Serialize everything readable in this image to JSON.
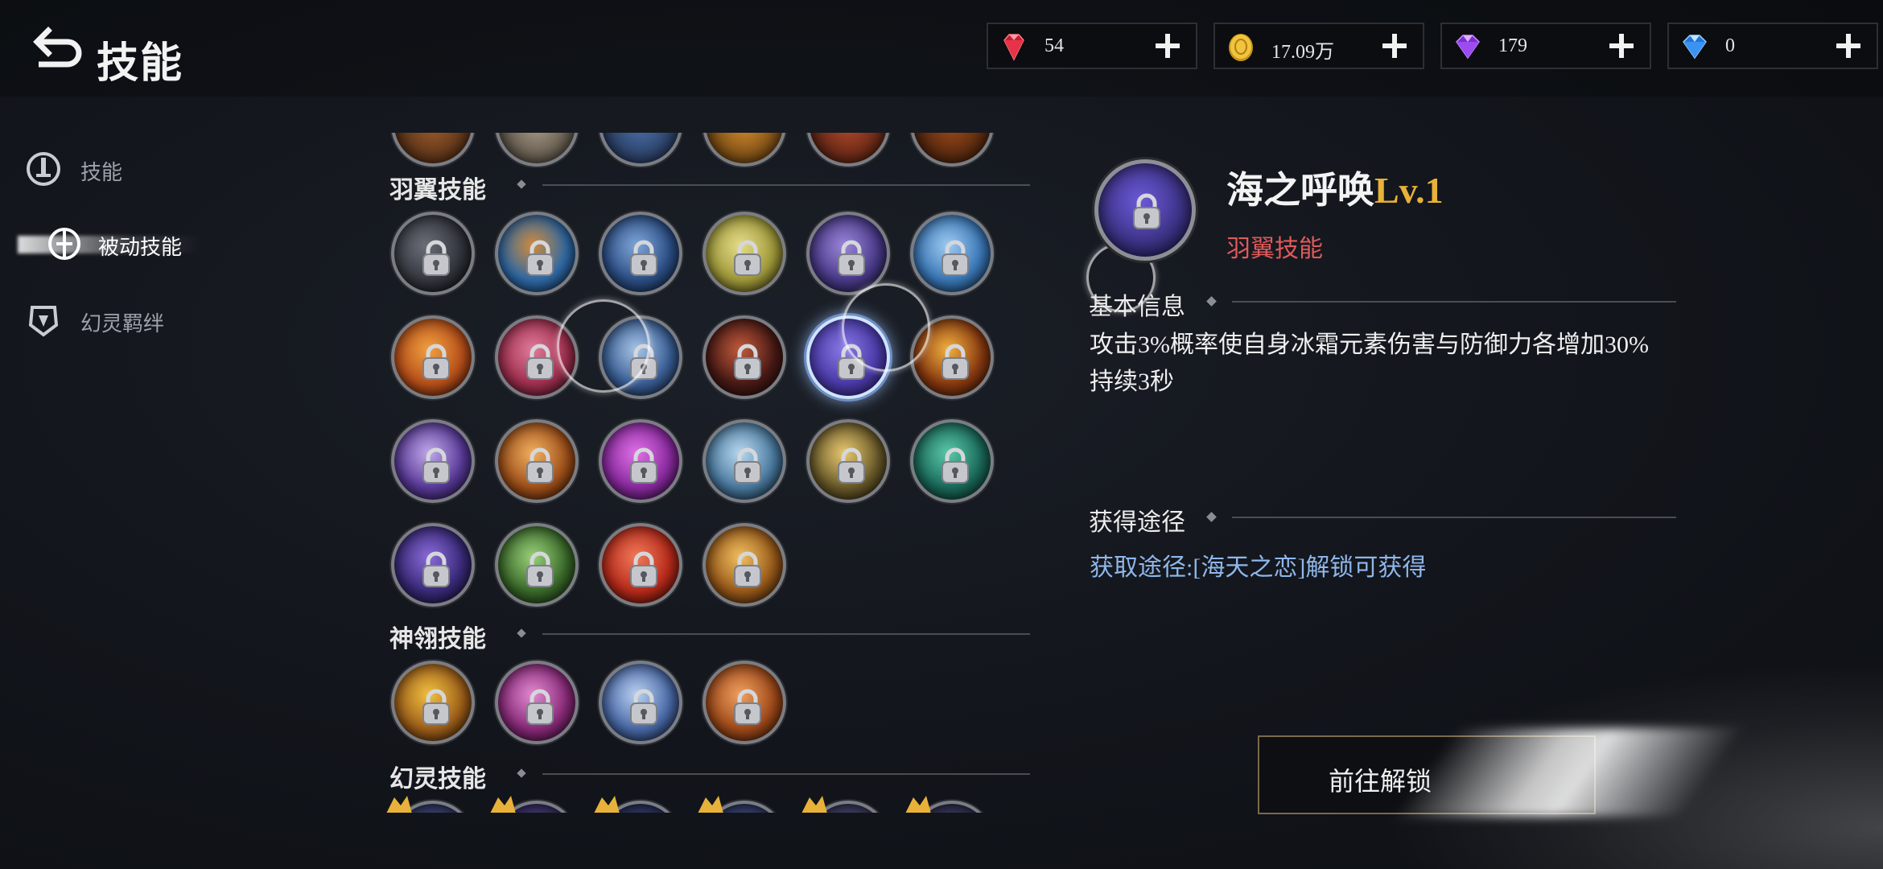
{
  "header": {
    "title": "技能",
    "back_icon": "back-arrow-icon"
  },
  "currencies": [
    {
      "name": "ruby",
      "icon": "red-gem-icon",
      "value": "54",
      "color": "#d3243a"
    },
    {
      "name": "gold",
      "icon": "gold-coin-icon",
      "value": "17.09万",
      "color": "#d9a921"
    },
    {
      "name": "amethyst",
      "icon": "purple-gem-icon",
      "value": "179",
      "color": "#8a3fe0"
    },
    {
      "name": "sapphire",
      "icon": "blue-gem-icon",
      "value": "0",
      "color": "#3a8ef0"
    }
  ],
  "sidebar": {
    "items": [
      {
        "label": "技能",
        "icon": "sword-emblem-icon",
        "active": false
      },
      {
        "label": "被动技能",
        "icon": "passive-skill-icon",
        "active": true
      },
      {
        "label": "幻灵羁绊",
        "icon": "phantom-bond-icon",
        "active": false
      }
    ]
  },
  "sections": {
    "wing": "羽翼技能",
    "divine_feather": "神翎技能",
    "phantom": "幻灵技能"
  },
  "selected_skill": {
    "name": "海之呼唤",
    "level": "Lv.1",
    "category": "羽翼技能",
    "basic_info_label": "基本信息",
    "description": "攻击3%概率使自身冰霜元素伤害与防御力各增加30%持续3秒",
    "acquire_label": "获得途径",
    "source": "获取途径:[海天之恋]解锁可获得",
    "button_label": "前往解锁"
  },
  "icons": {
    "lock": "padlock-icon",
    "section_marker": "diamond-icon"
  },
  "colors": {
    "level": "#e8b23a",
    "category": "#e05a5a",
    "source_link": "#8fb7ea"
  }
}
